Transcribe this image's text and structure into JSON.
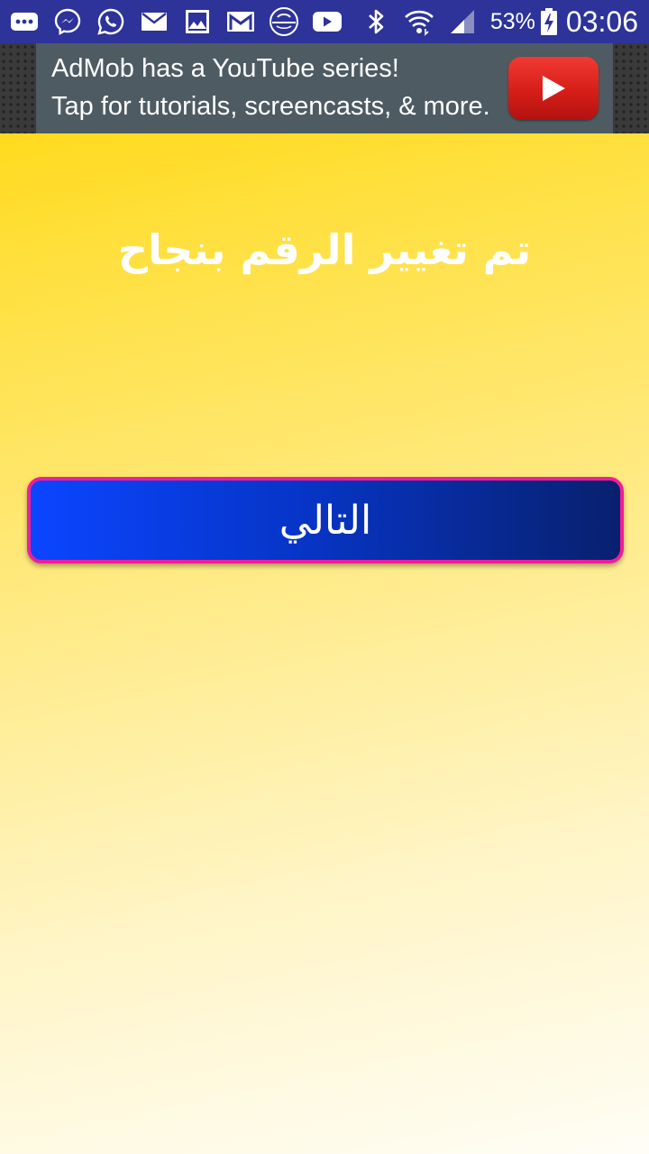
{
  "status_bar": {
    "icons": [
      "more-icon",
      "messenger-icon",
      "whatsapp-icon",
      "email-icon",
      "gallery-icon",
      "gmail-icon",
      "app-logo-icon",
      "youtube-icon",
      "bluetooth-icon",
      "wifi-icon",
      "signal-icon",
      "battery-charging-icon"
    ],
    "battery_percent": "53%",
    "time": "03:06",
    "background": "#2d3399"
  },
  "ad": {
    "line1": "AdMob has a YouTube series!",
    "line2": "Tap for tutorials, screencasts, & more.",
    "play_icon": "youtube-play-icon",
    "background": "#4e5b62"
  },
  "main": {
    "headline": "تم تغيير الرقم بنجاح",
    "next_button_label": "التالي",
    "button_border_color": "#ee1e9a",
    "button_gradient": [
      "#0b45ff",
      "#08206e"
    ],
    "background_gradient": [
      "#ffd500",
      "#fffdf6"
    ]
  }
}
